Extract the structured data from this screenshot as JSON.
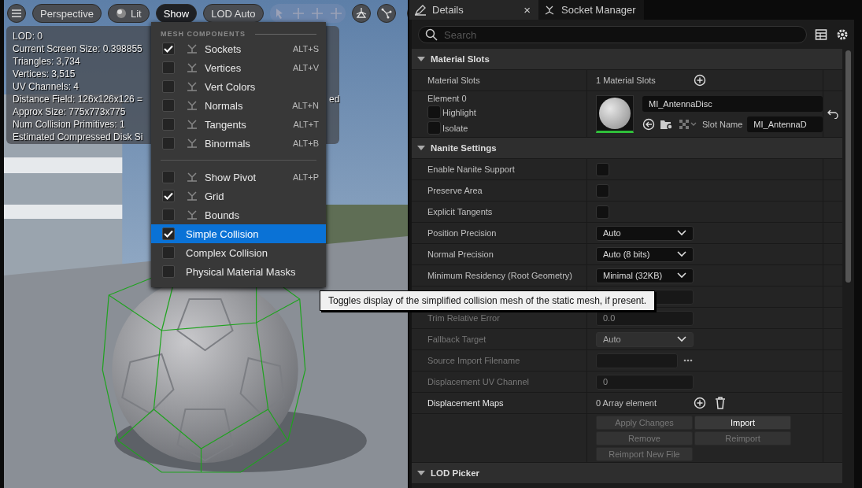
{
  "viewport": {
    "toolbar": [
      {
        "kind": "text",
        "label": "Perspective",
        "selected": false
      },
      {
        "kind": "lit",
        "label": "Lit",
        "selected": false
      },
      {
        "kind": "text",
        "label": "Show",
        "selected": true
      },
      {
        "kind": "text",
        "label": "LOD Auto",
        "selected": false
      }
    ],
    "stats": {
      "lines": [
        "LOD:  0",
        "Current Screen Size:  0.398855",
        "Triangles:  3,734",
        "Vertices:  3,515",
        "UV Channels:  4",
        "Distance Field:  126x126x126 =",
        "Approx Size: 775x773x775",
        "Num Collision Primitives:  1",
        "Estimated Compressed Disk Si"
      ],
      "fragment": "ed"
    },
    "show_menu": {
      "heading": "MESH COMPONENTS",
      "groups": [
        [
          {
            "kind": "icon",
            "label": "Sockets",
            "shortcut": "ALT+S",
            "checked": true,
            "selected": false
          },
          {
            "kind": "icon",
            "label": "Vertices",
            "shortcut": "ALT+V",
            "checked": false,
            "selected": false
          },
          {
            "kind": "icon",
            "label": "Vert Colors",
            "checked": false,
            "selected": false
          },
          {
            "kind": "icon",
            "label": "Normals",
            "shortcut": "ALT+N",
            "checked": false,
            "selected": false
          },
          {
            "kind": "icon",
            "label": "Tangents",
            "shortcut": "ALT+T",
            "checked": false,
            "selected": false
          },
          {
            "kind": "icon",
            "label": "Binormals",
            "shortcut": "ALT+B",
            "checked": false,
            "selected": false
          }
        ],
        [
          {
            "kind": "icon",
            "label": "Show Pivot",
            "shortcut": "ALT+P",
            "checked": false,
            "selected": false
          },
          {
            "kind": "icon",
            "label": "Grid",
            "checked": true,
            "selected": false
          },
          {
            "kind": "icon",
            "label": "Bounds",
            "checked": false,
            "selected": false
          },
          {
            "kind": "plain",
            "label": "Simple Collision",
            "checked": true,
            "selected": true
          },
          {
            "kind": "plain",
            "label": "Complex Collision",
            "checked": false,
            "selected": false
          },
          {
            "kind": "plain",
            "label": "Physical Material Masks",
            "checked": false,
            "selected": false
          }
        ]
      ]
    }
  },
  "tooltip": "Toggles display of the simplified collision mesh of the static mesh, if present.",
  "details": {
    "tabs": [
      {
        "label": "Details",
        "selected": true,
        "close": "×"
      },
      {
        "label": "Socket Manager",
        "selected": false
      }
    ],
    "search": {
      "placeholder": "Search"
    },
    "sections": [
      {
        "title": "Material Slots",
        "expanded": true,
        "rows": [
          {
            "kind": "array",
            "label": "Material Slots",
            "value": "1 Material Slots"
          },
          {
            "kind": "material",
            "label": "Element 0",
            "options": [
              {
                "label": "Highlight",
                "checked": false
              },
              {
                "label": "Isolate",
                "checked": false
              }
            ],
            "material": "MI_AntennaDisc",
            "slot_label": "Slot Name",
            "slot_name": "MI_AntennaD"
          }
        ]
      },
      {
        "title": "Nanite Settings",
        "expanded": true,
        "rows": [
          {
            "kind": "checkbox",
            "label": "Enable Nanite Support",
            "checked": false
          },
          {
            "kind": "checkbox",
            "label": "Preserve Area",
            "checked": false
          },
          {
            "kind": "checkbox",
            "label": "Explicit Tangents",
            "checked": false
          },
          {
            "kind": "dropdown",
            "label": "Position Precision",
            "value": "Auto",
            "disabled": false
          },
          {
            "kind": "dropdown",
            "label": "Normal Precision",
            "value": "Auto (8 bits)",
            "disabled": false
          },
          {
            "kind": "dropdown",
            "label": "Minimum Residency (Root Geometry)",
            "value": "Minimal (32KB)",
            "disabled": false
          },
          {
            "kind": "field",
            "disabled": true
          },
          {
            "kind": "field",
            "label": "Trim Relative Error",
            "value": "0.0",
            "disabled": true
          },
          {
            "kind": "dropdown",
            "label": "Fallback Target",
            "value": "Auto",
            "disabled": true
          },
          {
            "kind": "file",
            "label": "Source Import Filename",
            "disabled": true
          },
          {
            "kind": "field",
            "label": "Displacement UV Channel",
            "value": "0",
            "disabled": true
          },
          {
            "kind": "array",
            "label": "Displacement Maps",
            "value": "0 Array element",
            "deletable": true
          },
          {
            "kind": "buttons",
            "buttons": [
              {
                "label": "Apply Changes",
                "disabled": true
              },
              {
                "label": "Import",
                "disabled": false
              },
              {
                "label": "Remove",
                "disabled": true
              },
              {
                "label": "Reimport",
                "disabled": true
              },
              {
                "label": "Reimport New File",
                "disabled": true
              }
            ]
          }
        ]
      },
      {
        "title": "LOD Picker",
        "expanded": true
      }
    ]
  }
}
